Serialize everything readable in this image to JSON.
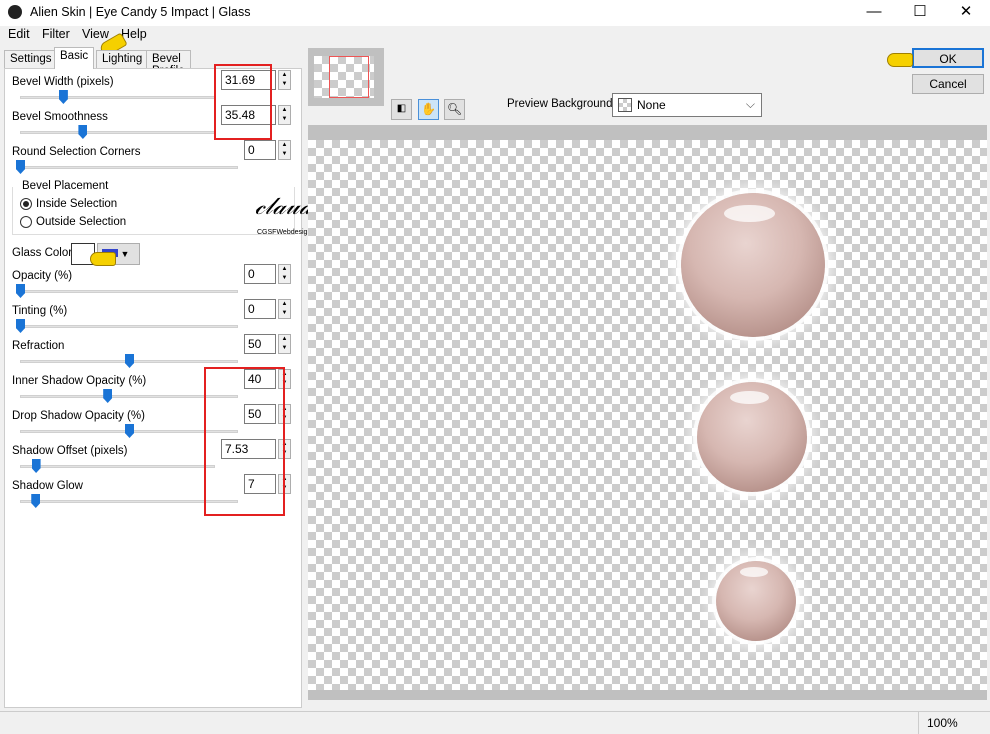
{
  "window": {
    "title": "Alien Skin | Eye Candy 5 Impact | Glass",
    "minimize": "—",
    "maximize": "☐",
    "close": "✕"
  },
  "menu": [
    "Edit",
    "Filter",
    "View",
    "Help"
  ],
  "tabs": [
    {
      "label": "Settings"
    },
    {
      "label": "Basic",
      "active": true
    },
    {
      "label": "Lighting"
    },
    {
      "label": "Bevel Profile"
    }
  ],
  "controls": [
    {
      "label": "Bevel Width (pixels)",
      "value": "31.69",
      "slider_level": 0.22
    },
    {
      "label": "Bevel Smoothness",
      "value": "35.48",
      "slider_level": 0.32
    },
    {
      "label": "Round Selection Corners",
      "value": "0",
      "slider_level": 0
    }
  ],
  "bevel_placement": {
    "title": "Bevel Placement",
    "options": [
      {
        "label": "Inside Selection",
        "checked": true
      },
      {
        "label": "Outside Selection",
        "checked": false
      }
    ]
  },
  "glass_color": {
    "label": "Glass Color",
    "swatch": "#ffffff"
  },
  "controls2": [
    {
      "label": "Opacity (%)",
      "value": "0",
      "slider_level": 0
    },
    {
      "label": "Tinting (%)",
      "value": "0",
      "slider_level": 0
    },
    {
      "label": "Refraction",
      "value": "50",
      "slider_level": 0.5
    },
    {
      "label": "Inner Shadow Opacity (%)",
      "value": "40",
      "slider_level": 0.4
    },
    {
      "label": "Drop Shadow Opacity (%)",
      "value": "50",
      "slider_level": 0.5
    },
    {
      "label": "Shadow Offset (pixels)",
      "value": "7.53",
      "slider_level": 0.08
    },
    {
      "label": "Shadow Glow",
      "value": "7",
      "slider_level": 0.07
    }
  ],
  "watermark": {
    "name": "Claudia",
    "sub": "CGSFWebdesign"
  },
  "buttons": {
    "ok": "OK",
    "cancel": "Cancel"
  },
  "preview": {
    "bg_label": "Preview Background:",
    "bg_value": "None"
  },
  "status": {
    "zoom": "100%"
  },
  "colors": {
    "accent": "#1a74d6",
    "highlight": "#e32020"
  }
}
